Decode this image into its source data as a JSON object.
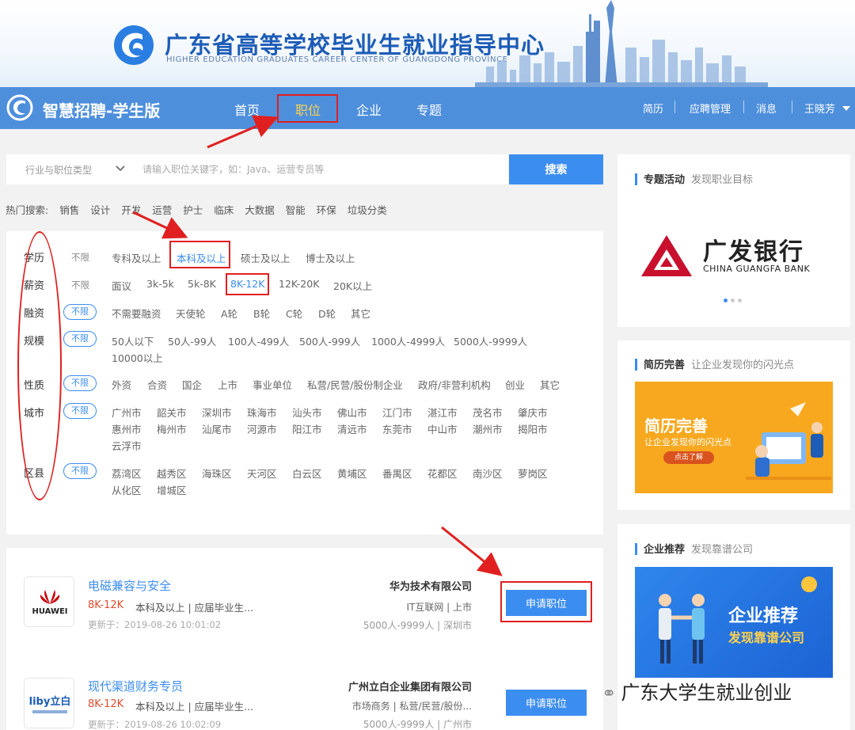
{
  "banner": {
    "title": "广东省高等学校毕业生就业指导中心",
    "subtitle": "HIGHER EDUCATION GRADUATES CAREER CENTER OF GUANGDONG PROVINCE"
  },
  "nav": {
    "brand": "智慧招聘-学生版",
    "tabs": [
      {
        "label": "首页"
      },
      {
        "label": "职位",
        "active": true
      },
      {
        "label": "企业"
      },
      {
        "label": "专题"
      }
    ],
    "right": [
      "简历",
      "应聘管理",
      "消息",
      "王晓芳"
    ]
  },
  "search": {
    "type_label": "行业与职位类型",
    "placeholder": "请输入职位关键字，如：Java、运营专员等",
    "button": "搜索"
  },
  "hot": {
    "label": "热门搜索:",
    "items": [
      "销售",
      "设计",
      "开发",
      "运营",
      "护士",
      "临床",
      "大数据",
      "智能",
      "环保",
      "垃圾分类"
    ]
  },
  "filters": {
    "education": {
      "label": "学历",
      "any": "不限",
      "options": [
        "专科及以上",
        "本科及以上",
        "硕士及以上",
        "博士及以上"
      ],
      "selected": "本科及以上"
    },
    "salary": {
      "label": "薪资",
      "any": "不限",
      "options": [
        "面议",
        "3k-5k",
        "5k-8K",
        "8K-12K",
        "12K-20K",
        "20K以上"
      ],
      "selected": "8K-12K"
    },
    "funding": {
      "label": "融资",
      "any": "不限",
      "options": [
        "不需要融资",
        "天使轮",
        "A轮",
        "B轮",
        "C轮",
        "D轮",
        "其它"
      ]
    },
    "scale": {
      "label": "规模",
      "any": "不限",
      "options": [
        "50人以下",
        "50人-99人",
        "100人-499人",
        "500人-999人",
        "1000人-4999人",
        "5000人-9999人",
        "10000以上"
      ]
    },
    "nature": {
      "label": "性质",
      "any": "不限",
      "options": [
        "外资",
        "合资",
        "国企",
        "上市",
        "事业单位",
        "私营/民营/股份制企业",
        "政府/非营利机构",
        "创业",
        "其它"
      ]
    },
    "city": {
      "label": "城市",
      "any": "不限",
      "options": [
        "广州市",
        "韶关市",
        "深圳市",
        "珠海市",
        "汕头市",
        "佛山市",
        "江门市",
        "湛江市",
        "茂名市",
        "肇庆市",
        "惠州市",
        "梅州市",
        "汕尾市",
        "河源市",
        "阳江市",
        "清远市",
        "东莞市",
        "中山市",
        "潮州市",
        "揭阳市",
        "云浮市"
      ]
    },
    "district": {
      "label": "区县",
      "any": "不限",
      "options": [
        "荔湾区",
        "越秀区",
        "海珠区",
        "天河区",
        "白云区",
        "黄埔区",
        "番禺区",
        "花都区",
        "南沙区",
        "萝岗区",
        "从化区",
        "增城区"
      ]
    }
  },
  "jobs": [
    {
      "title": "电磁兼容与安全",
      "salary": "8K-12K",
      "meta": "本科及以上 | 应届毕业生...",
      "date": "更新于：2019-08-26 10:01:02",
      "company": "华为技术有限公司",
      "industry": "IT互联网 | 上市",
      "size": "5000人-9999人 | 深圳市",
      "logo_text": "HUAWEI",
      "apply": "申请职位"
    },
    {
      "title": "现代渠道财务专员",
      "salary": "8K-12K",
      "meta": "本科及以上 | 应届毕业生...",
      "date": "更新于：2019-08-26 10:02:09",
      "company": "广州立白企业集团有限公司",
      "industry": "市场商务 | 私营/民营/股份...",
      "size": "5000人-9999人 | 广州市",
      "logo_text": "liby立白",
      "apply": "申请职位"
    }
  ],
  "sidebar": {
    "topic": {
      "head": "专题活动",
      "sub": "发现职业目标",
      "bank_cn": "广发银行",
      "bank_en": "CHINA GUANGFA BANK"
    },
    "resume": {
      "head": "简历完善",
      "sub": "让企业发现你的闪光点",
      "banner_title": "简历完善",
      "banner_sub": "让企业发现你的闪光点",
      "banner_btn": "点击了解"
    },
    "company": {
      "head": "企业推荐",
      "sub": "发现靠谱公司",
      "banner_title": "企业推荐",
      "banner_sub": "发现靠谱公司"
    }
  },
  "watermark": "广东大学生就业创业",
  "colors": {
    "nav": "#4e8fdc",
    "accent": "#3c8df0",
    "salary": "#e34a2e",
    "annotation": "#e02020"
  }
}
